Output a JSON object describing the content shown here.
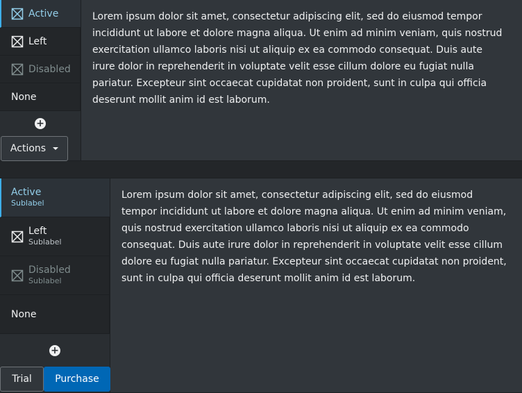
{
  "panel1": {
    "tabs": [
      {
        "label": "Active",
        "state": "active",
        "icon": "checkbox-crossed-icon"
      },
      {
        "label": "Left",
        "state": "normal",
        "icon": "checkbox-crossed-icon"
      },
      {
        "label": "Disabled",
        "state": "disabled",
        "icon": "checkbox-crossed-icon"
      },
      {
        "label": "None",
        "state": "normal",
        "icon": null
      }
    ],
    "add_icon": "plus-circle-icon",
    "actions_label": "Actions",
    "text": "Lorem ipsum dolor sit amet, consectetur adipiscing elit, sed do eiusmod tempor incididunt ut labore et dolore magna aliqua. Ut enim ad minim veniam, quis nostrud exercitation ullamco laboris nisi ut aliquip ex ea commodo consequat. Duis aute irure dolor in reprehenderit in voluptate velit esse cillum dolore eu fugiat nulla pariatur. Excepteur sint occaecat cupidatat non proident, sunt in culpa qui officia deserunt mollit anim id est laborum."
  },
  "panel2": {
    "tabs": [
      {
        "label": "Active",
        "sublabel": "Sublabel",
        "state": "active",
        "icon": null
      },
      {
        "label": "Left",
        "sublabel": "Sublabel",
        "state": "normal",
        "icon": "checkbox-crossed-icon"
      },
      {
        "label": "Disabled",
        "sublabel": "Sublabel",
        "state": "disabled",
        "icon": "checkbox-crossed-icon"
      },
      {
        "label": "None",
        "state": "normal",
        "icon": null
      }
    ],
    "add_icon": "plus-circle-icon",
    "trial_label": "Trial",
    "purchase_label": "Purchase",
    "text": "Lorem ipsum dolor sit amet, consectetur adipiscing elit, sed do eiusmod tempor incididunt ut labore et dolore magna aliqua. Ut enim ad minim veniam, quis nostrud exercitation ullamco laboris nisi ut aliquip ex ea commodo consequat. Duis aute irure dolor in reprehenderit in voluptate velit esse cillum dolore eu fugiat nulla pariatur. Excepteur sint occaecat cupidatat non proident, sunt in culpa qui officia deserunt mollit anim id est laborum."
  },
  "colors": {
    "accent": "#3daee9",
    "primary_button": "#0067b5",
    "panel_bg": "#31363b",
    "window_bg": "#232629"
  }
}
